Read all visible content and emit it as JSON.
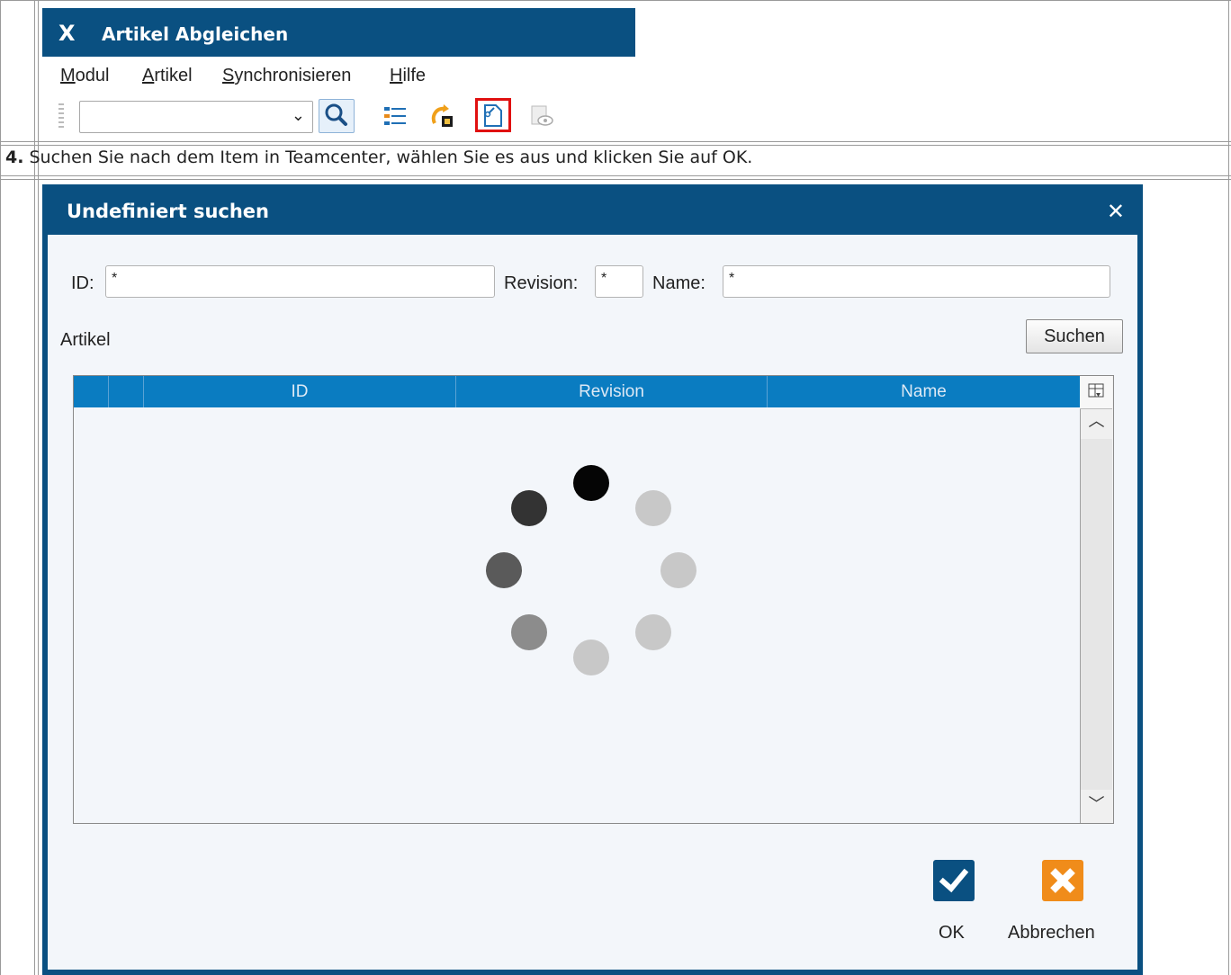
{
  "window1": {
    "title_glyph": "X",
    "title": "Artikel Abgleichen",
    "menu": [
      {
        "first": "M",
        "rest": "odul"
      },
      {
        "first": "A",
        "rest": "rtikel"
      },
      {
        "first": "S",
        "rest": "ynchronisieren"
      },
      {
        "first": "H",
        "rest": "ilfe"
      }
    ],
    "toolbar_icons": [
      "search-icon",
      "list-icon",
      "sync-icon",
      "link-document-icon",
      "view-icon"
    ]
  },
  "step": {
    "number": "4.",
    "text": " Suchen Sie nach dem Item in Teamcenter, wählen Sie es aus und klicken Sie auf OK."
  },
  "dialog": {
    "title": "Undefiniert suchen",
    "close_glyph": "✕",
    "fields": {
      "id_label": "ID:",
      "id_value": "*",
      "revision_label": "Revision:",
      "revision_value": "*",
      "name_label": "Name:",
      "name_value": "*"
    },
    "section_label": "Artikel",
    "search_button": "Suchen",
    "columns": [
      "ID",
      "Revision",
      "Name"
    ],
    "ok_label": "OK",
    "cancel_label": "Abbrechen"
  },
  "colors": {
    "titlebar": "#0a5081",
    "header": "#0a7cc1",
    "highlight": "#e01010",
    "cancel_accent": "#f08c1a"
  }
}
